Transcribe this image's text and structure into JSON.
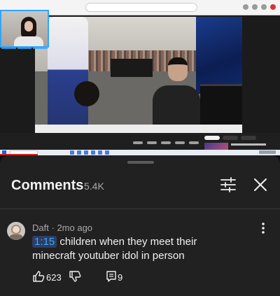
{
  "sheet": {
    "title": "Comments",
    "count": "5.4K",
    "sort_icon": "sliders-icon",
    "close_icon": "close-icon"
  },
  "comment": {
    "author": "Daft",
    "separator": "·",
    "age": "2mo ago",
    "timestamp": "1:15",
    "text": " children when they meet their minecraft youtuber idol in person",
    "likes": "623",
    "replies": "9",
    "like_icon": "thumbs-up-icon",
    "dislike_icon": "thumbs-down-icon",
    "reply_icon": "reply-icon",
    "more_icon": "kebab-menu-icon"
  },
  "colors": {
    "background": "#0f0f0f",
    "sheet": "#212121",
    "timestamp_link": "#3ea6ff",
    "secondary_text": "#aaaaaa"
  }
}
